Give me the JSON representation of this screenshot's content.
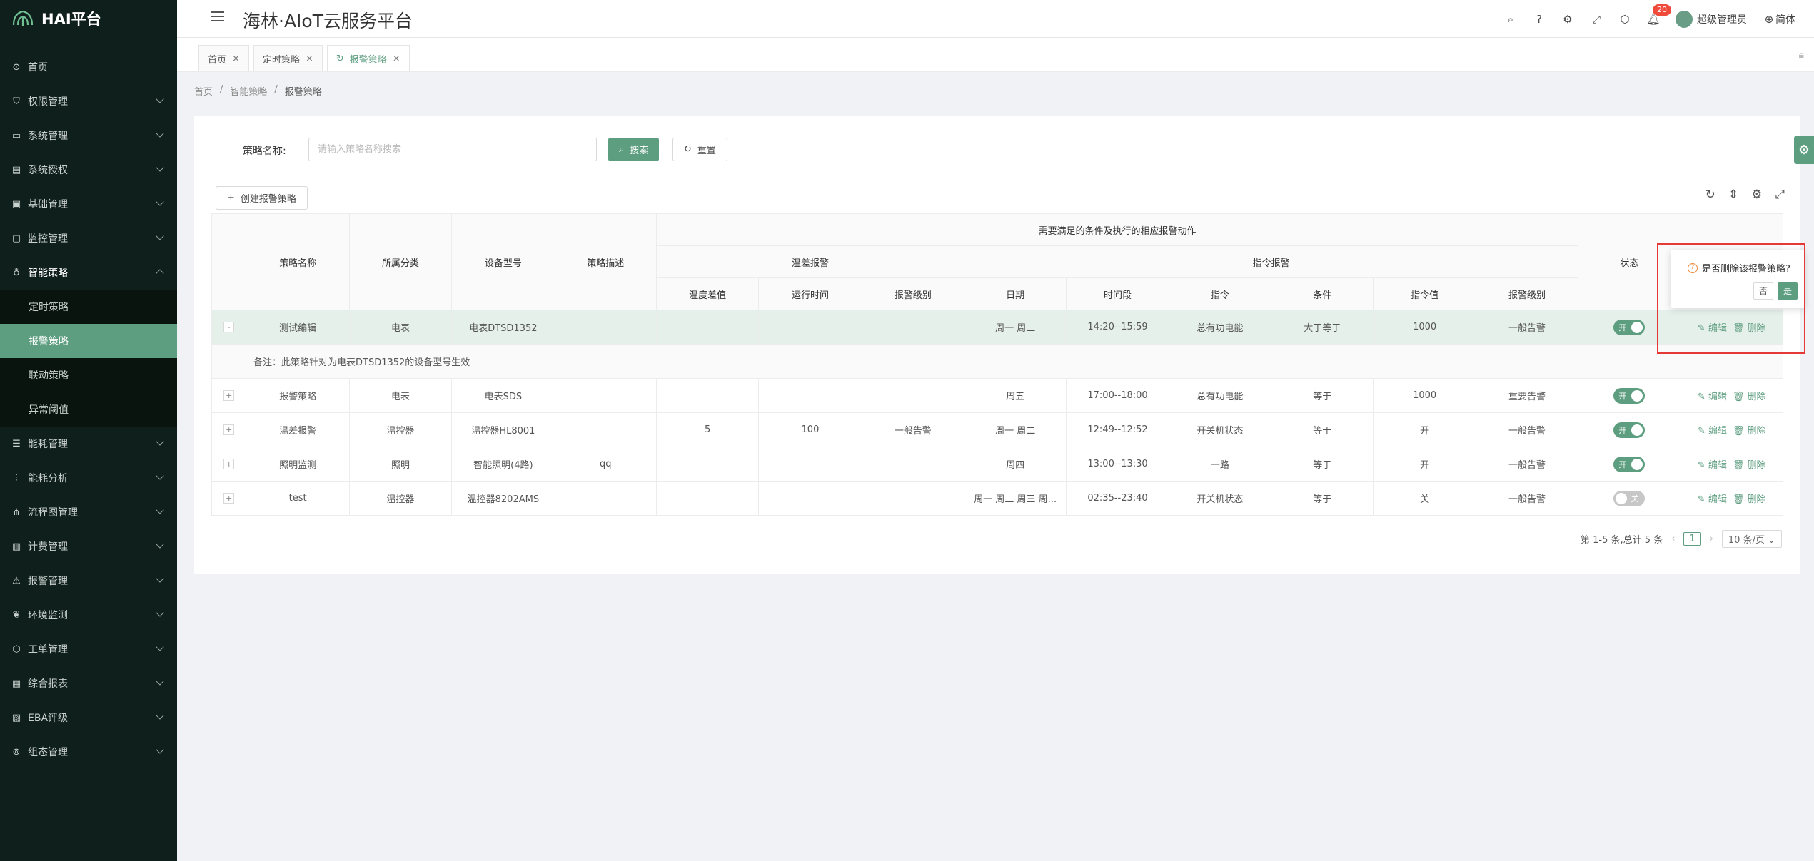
{
  "brand": "HAI平台",
  "app_title": "海林·AIoT云服务平台",
  "header": {
    "notification_count": "20",
    "user_name": "超级管理员",
    "language": "简体"
  },
  "sidebar": {
    "items": [
      {
        "label": "首页",
        "icon": "home-icon"
      },
      {
        "label": "权限管理",
        "icon": "shield-icon"
      },
      {
        "label": "系统管理",
        "icon": "monitor-icon"
      },
      {
        "label": "系统授权",
        "icon": "license-icon"
      },
      {
        "label": "基础管理",
        "icon": "box-icon"
      },
      {
        "label": "监控管理",
        "icon": "monitor-icon"
      },
      {
        "label": "智能策略",
        "icon": "bulb-icon"
      }
    ],
    "sub_items": [
      "定时策略",
      "报警策略",
      "联动策略",
      "异常阈值"
    ],
    "items_after": [
      {
        "label": "能耗管理",
        "icon": "list-icon"
      },
      {
        "label": "能耗分析",
        "icon": "chart-icon"
      },
      {
        "label": "流程图管理",
        "icon": "flow-icon"
      },
      {
        "label": "计费管理",
        "icon": "bill-icon"
      },
      {
        "label": "报警管理",
        "icon": "alarm-icon"
      },
      {
        "label": "环境监测",
        "icon": "leaf-icon"
      },
      {
        "label": "工单管理",
        "icon": "ticket-icon"
      },
      {
        "label": "综合报表",
        "icon": "report-icon"
      },
      {
        "label": "EBA评级",
        "icon": "rating-icon"
      },
      {
        "label": "组态管理",
        "icon": "config-icon"
      }
    ]
  },
  "tabs": [
    "首页",
    "定时策略",
    "报警策略"
  ],
  "breadcrumb": [
    "首页",
    "智能策略",
    "报警策略"
  ],
  "search": {
    "label": "策略名称:",
    "placeholder": "请输入策略名称搜索",
    "search_btn": "搜索",
    "reset_btn": "重置"
  },
  "create_btn": "创建报警策略",
  "table": {
    "header_top": "需要满足的条件及执行的相应报警动作",
    "group_temp": "温差报警",
    "group_cmd": "指令报警",
    "cols": {
      "name": "策略名称",
      "category": "所属分类",
      "model": "设备型号",
      "desc": "策略描述",
      "temp_diff": "温度差值",
      "run_time": "运行时间",
      "temp_level": "报警级别",
      "date": "日期",
      "time_range": "时间段",
      "cmd": "指令",
      "cond": "条件",
      "cmd_val": "指令值",
      "cmd_level": "报警级别",
      "status": "状态"
    },
    "rows": [
      {
        "name": "测试编辑",
        "category": "电表",
        "model": "电表DTSD1352",
        "desc": "",
        "temp_diff": "",
        "run_time": "",
        "temp_level": "",
        "date": "周一 周二",
        "time_range": "14:20--15:59",
        "cmd": "总有功电能",
        "cond": "大于等于",
        "cmd_val": "1000",
        "cmd_level": "一般告警",
        "status": "开",
        "expand": "-"
      },
      {
        "name": "报警策略",
        "category": "电表",
        "model": "电表SDS",
        "desc": "",
        "temp_diff": "",
        "run_time": "",
        "temp_level": "",
        "date": "周五",
        "time_range": "17:00--18:00",
        "cmd": "总有功电能",
        "cond": "等于",
        "cmd_val": "1000",
        "cmd_level": "重要告警",
        "status": "开",
        "expand": "+"
      },
      {
        "name": "温差报警",
        "category": "温控器",
        "model": "温控器HL8001",
        "desc": "",
        "temp_diff": "5",
        "run_time": "100",
        "temp_level": "一般告警",
        "date": "周一 周二",
        "time_range": "12:49--12:52",
        "cmd": "开关机状态",
        "cond": "等于",
        "cmd_val": "开",
        "cmd_level": "一般告警",
        "status": "开",
        "expand": "+"
      },
      {
        "name": "照明监测",
        "category": "照明",
        "model": "智能照明(4路)",
        "desc": "qq",
        "temp_diff": "",
        "run_time": "",
        "temp_level": "",
        "date": "周四",
        "time_range": "13:00--13:30",
        "cmd": "一路",
        "cond": "等于",
        "cmd_val": "开",
        "cmd_level": "一般告警",
        "status": "开",
        "expand": "+"
      },
      {
        "name": "test",
        "category": "温控器",
        "model": "温控器8202AMS",
        "desc": "",
        "temp_diff": "",
        "run_time": "",
        "temp_level": "",
        "date": "周一 周二 周三 周...",
        "time_range": "02:35--23:40",
        "cmd": "开关机状态",
        "cond": "等于",
        "cmd_val": "关",
        "cmd_level": "一般告警",
        "status": "关",
        "expand": "+"
      }
    ],
    "note": "备注：此策略针对为电表DTSD1352的设备型号生效",
    "edit": "编辑",
    "delete": "删除"
  },
  "pager": {
    "summary": "第 1-5 条,总计 5 条",
    "page": "1",
    "size": "10 条/页"
  },
  "popconfirm": {
    "question": "是否删除该报警策略?",
    "no": "否",
    "yes": "是"
  },
  "colors": {
    "accent": "#5e9e80",
    "sidebar_bg": "#0f1f1b",
    "highlight_row": "#e6f0eb",
    "annotation_box": "#e53935"
  }
}
